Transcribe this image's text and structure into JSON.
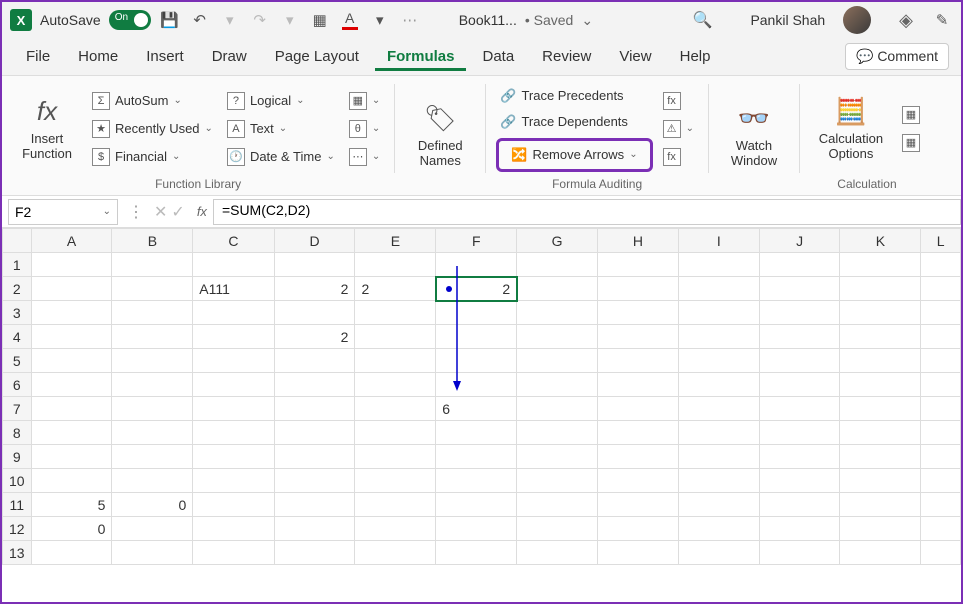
{
  "titlebar": {
    "autosave": "AutoSave",
    "toggle_state": "On",
    "filename": "Book11...",
    "saved_status": "• Saved",
    "username": "Pankil Shah"
  },
  "menu": {
    "tabs": [
      "File",
      "Home",
      "Insert",
      "Draw",
      "Page Layout",
      "Formulas",
      "Data",
      "Review",
      "View",
      "Help"
    ],
    "active_index": 5,
    "comment": "Comment"
  },
  "ribbon": {
    "insert_function": "Insert\nFunction",
    "autosum": "AutoSum",
    "recently_used": "Recently Used",
    "financial": "Financial",
    "logical": "Logical",
    "text": "Text",
    "date_time": "Date & Time",
    "function_library": "Function Library",
    "defined_names": "Defined\nNames",
    "trace_precedents": "Trace Precedents",
    "trace_dependents": "Trace Dependents",
    "remove_arrows": "Remove Arrows",
    "formula_auditing": "Formula Auditing",
    "watch_window": "Watch\nWindow",
    "calculation_options": "Calculation\nOptions",
    "calculation": "Calculation"
  },
  "formula_bar": {
    "name_box": "F2",
    "formula": "=SUM(C2,D2)"
  },
  "grid": {
    "columns": [
      "A",
      "B",
      "C",
      "D",
      "E",
      "F",
      "G",
      "H",
      "I",
      "J",
      "K",
      "L"
    ],
    "rows": [
      1,
      2,
      3,
      4,
      5,
      6,
      7,
      8,
      9,
      10,
      11,
      12,
      13
    ],
    "cells": {
      "C2": "A111",
      "D2": "2",
      "E2": "2",
      "F2": "2",
      "D4": "2",
      "F7": "6",
      "A11": "5",
      "B11": "0",
      "A12": "0"
    },
    "selected": "F2"
  }
}
